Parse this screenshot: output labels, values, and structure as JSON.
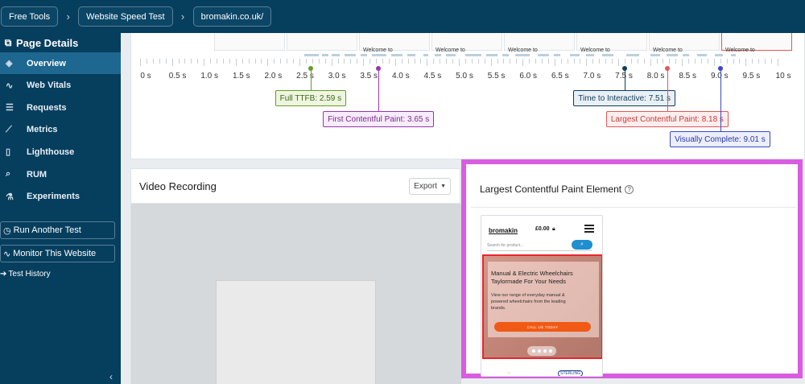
{
  "breadcrumb": [
    {
      "label": "Free Tools"
    },
    {
      "label": "Website Speed Test"
    },
    {
      "label": "bromakin.co.uk/"
    }
  ],
  "sidebar": {
    "title": "Page Details",
    "items": [
      {
        "label": "Overview",
        "icon": "layers-icon",
        "glyph": "◈",
        "active": true
      },
      {
        "label": "Web Vitals",
        "icon": "pulse-icon",
        "glyph": "∿",
        "active": false
      },
      {
        "label": "Requests",
        "icon": "list-icon",
        "glyph": "☰",
        "active": false
      },
      {
        "label": "Metrics",
        "icon": "chart-line-icon",
        "glyph": "⟋",
        "active": false
      },
      {
        "label": "Lighthouse",
        "icon": "lighthouse-icon",
        "glyph": "▯",
        "active": false
      },
      {
        "label": "RUM",
        "icon": "search-icon",
        "glyph": "⌕",
        "active": false
      },
      {
        "label": "Experiments",
        "icon": "flask-icon",
        "glyph": "⚗",
        "active": false
      }
    ],
    "run_another_test": "Run Another Test",
    "monitor_website": "Monitor This Website",
    "test_history": "Test History"
  },
  "timeline": {
    "thumbnail_labels": [
      "Welcome to",
      "Welcome to",
      "Welcome to",
      "Welcome to",
      "Welcome to",
      "Welcome to"
    ],
    "ticks": [
      "0 s",
      "0.5 s",
      "1.0 s",
      "1.5 s",
      "2.0 s",
      "2.5 s",
      "3.0 s",
      "3.5 s",
      "4.0 s",
      "4.5 s",
      "5.0 s",
      "5.5 s",
      "6.0 s",
      "6.5 s",
      "7.0 s",
      "7.5 s",
      "8.0 s",
      "8.5 s",
      "9.0 s",
      "9.5 s",
      "10 s"
    ],
    "max_seconds": 10,
    "markers": [
      {
        "label": "Full TTFB: 2.59 s",
        "time": 2.59,
        "color": "#6a9a2a",
        "bg": "#eef5e1",
        "text": "#3d6b12",
        "row": 0
      },
      {
        "label": "First Contentful Paint: 3.65 s",
        "time": 3.65,
        "color": "#9a35b5",
        "bg": "#f7ecfa",
        "text": "#7a2a92",
        "row": 1
      },
      {
        "label": "Time to Interactive: 7.51 s",
        "time": 7.51,
        "color": "#0e3c5c",
        "bg": "#e9f0f5",
        "text": "#0e3c5c",
        "row": 0
      },
      {
        "label": "Largest Contentful Paint: 8.18 s",
        "time": 8.18,
        "color": "#e25757",
        "bg": "#fdeeee",
        "text": "#c43a3a",
        "row": 1
      },
      {
        "label": "Visually Complete: 9.01 s",
        "time": 9.01,
        "color": "#3a48c4",
        "bg": "#eceefb",
        "text": "#2c38a8",
        "row": 2
      }
    ]
  },
  "video": {
    "title": "Video Recording",
    "export_label": "Export"
  },
  "lcp": {
    "title": "Largest Contentful Paint Element",
    "highlight_color": "#d85de0",
    "preview": {
      "logo": "bromakin",
      "price": "£0.00",
      "search_placeholder": "Search for product...",
      "heading": "Manual & Electric Wheelchairs Taylormade For Your Needs",
      "body": "View our range of everyday manual & powered wheelchairs from the leading brands.",
      "cta": "CALL US TODAY",
      "brand2": "STERLING"
    }
  }
}
